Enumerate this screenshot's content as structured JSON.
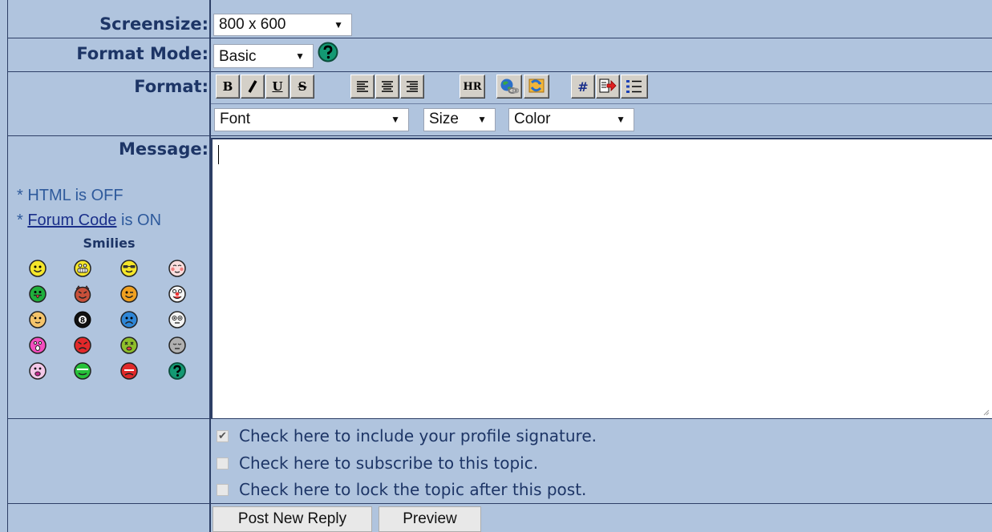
{
  "labels": {
    "screensize": "Screensize:",
    "format_mode": "Format Mode:",
    "format": "Format:",
    "message": "Message:"
  },
  "screensize_select": {
    "value": "800 x 600"
  },
  "format_mode_select": {
    "value": "Basic"
  },
  "format_mode_help_icon": "help-icon",
  "toolbar": {
    "bold": "B",
    "underline": "U",
    "strike": "S",
    "hr": "HR",
    "hash": "#",
    "buttons": [
      "bold",
      "italic",
      "underline",
      "strikethrough",
      "align-left",
      "align-center",
      "align-right",
      "horizontal-rule",
      "hyperlink",
      "image",
      "code",
      "quote",
      "list"
    ]
  },
  "font_select": {
    "value": "Font"
  },
  "size_select": {
    "value": "Size"
  },
  "color_select": {
    "value": "Color"
  },
  "side": {
    "html_status": "* HTML is OFF",
    "forum_code_prefix": "* ",
    "forum_code_link": "Forum Code",
    "forum_code_suffix": " is ON",
    "smilies_title": "Smilies"
  },
  "smilies": [
    "smile",
    "big-grin",
    "cool",
    "blush",
    "tongue",
    "evil",
    "wink",
    "clown",
    "shy",
    "8ball",
    "sad",
    "shock",
    "surprised",
    "angry",
    "dead",
    "sleepy",
    "kisses",
    "approve",
    "disapprove",
    "question"
  ],
  "message_textarea": {
    "value": ""
  },
  "checkboxes": [
    {
      "label": "Check here to include your profile signature.",
      "checked": true
    },
    {
      "label": "Check here to subscribe to this topic.",
      "checked": false
    },
    {
      "label": "Check here to lock the topic after this post.",
      "checked": false
    }
  ],
  "buttons": {
    "post": "Post New Reply",
    "preview": "Preview"
  },
  "colors": {
    "panel_bg": "#b0c4de",
    "label_text": "#1d3566",
    "border": "#2d3f66"
  }
}
